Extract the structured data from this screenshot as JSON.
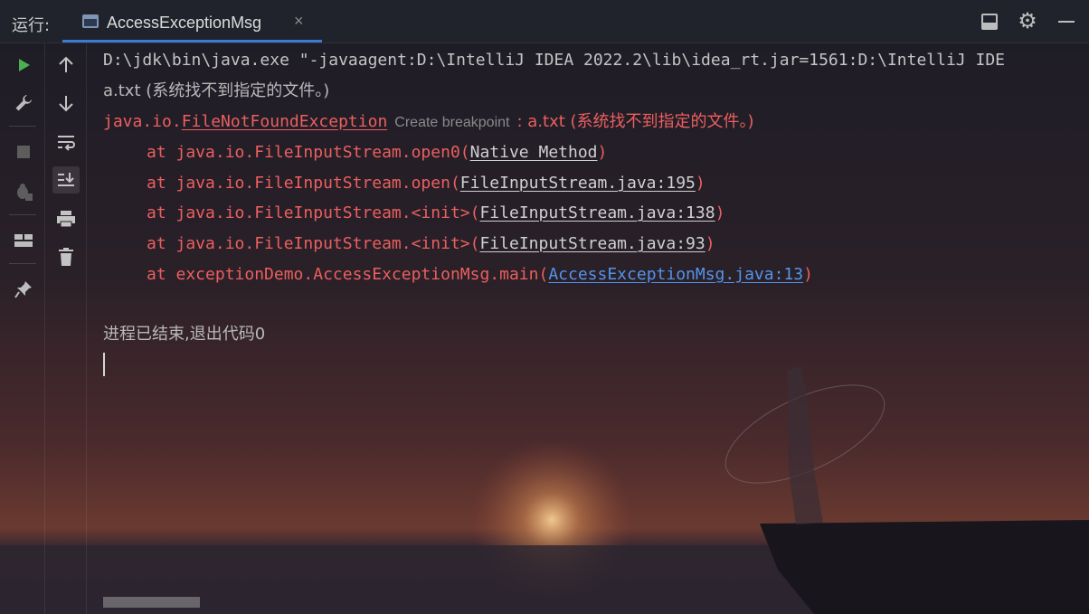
{
  "header": {
    "run_label": "运行:",
    "tab_title": "AccessExceptionMsg",
    "tab_close": "×"
  },
  "toolbar_left": [
    {
      "icon": "play-icon",
      "color": "#4caf50"
    },
    {
      "icon": "wrench-icon"
    },
    {
      "icon": "stop-icon"
    },
    {
      "icon": "debug-stop-icon"
    },
    {
      "icon": "layout-icon"
    },
    {
      "icon": "pin-icon"
    }
  ],
  "toolbar_right": [
    {
      "icon": "arrow-up-icon"
    },
    {
      "icon": "arrow-down-icon"
    },
    {
      "icon": "soft-wrap-icon"
    },
    {
      "icon": "scroll-to-end-icon"
    },
    {
      "icon": "print-icon"
    },
    {
      "icon": "trash-icon"
    }
  ],
  "console": {
    "command_line": "D:\\jdk\\bin\\java.exe \"-javaagent:D:\\IntelliJ IDEA 2022.2\\lib\\idea_rt.jar=1561:D:\\IntelliJ IDE",
    "line2": "a.txt (系统找不到指定的文件。)",
    "exception_prefix": "java.io.",
    "exception_class": "FileNotFoundException",
    "breakpoint_hint": "Create breakpoint",
    "exception_message": ": a.txt (系统找不到指定的文件。)",
    "stack": [
      {
        "at": "at java.io.FileInputStream.open0(",
        "link": "Native Method",
        "close": ")"
      },
      {
        "at": "at java.io.FileInputStream.open(",
        "link": "FileInputStream.java:195",
        "close": ")"
      },
      {
        "at": "at java.io.FileInputStream.<init>(",
        "link": "FileInputStream.java:138",
        "close": ")"
      },
      {
        "at": "at java.io.FileInputStream.<init>(",
        "link": "FileInputStream.java:93",
        "close": ")"
      },
      {
        "at": "at exceptionDemo.AccessExceptionMsg.main(",
        "link": "AccessExceptionMsg.java:13",
        "close": ")"
      }
    ],
    "exit_message": "进程已结束,退出代码0"
  },
  "colors": {
    "error_text": "#ec5f5f",
    "link_blue": "#5394ec",
    "tab_underline": "#3c7ad4",
    "run_green": "#4caf50"
  }
}
